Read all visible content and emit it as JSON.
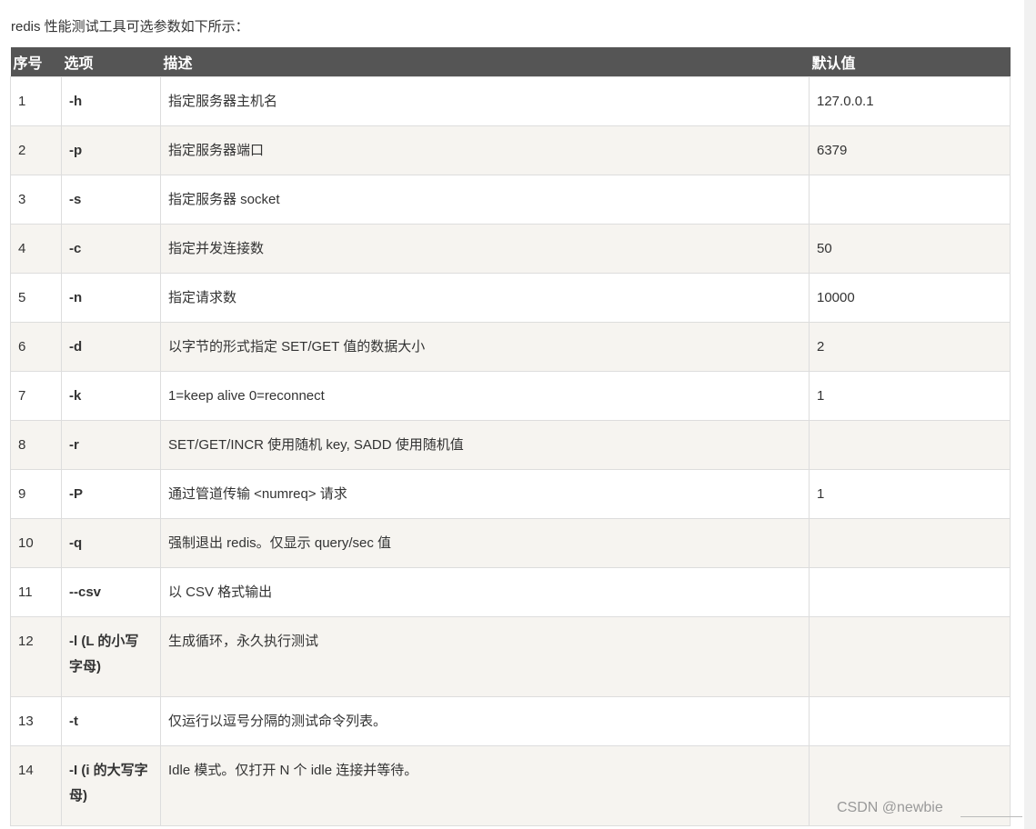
{
  "intro": "redis 性能测试工具可选参数如下所示：",
  "table": {
    "headers": [
      "序号",
      "选项",
      "描述",
      "默认值"
    ],
    "rows": [
      {
        "no": "1",
        "option": "-h",
        "desc": "指定服务器主机名",
        "default": "127.0.0.1"
      },
      {
        "no": "2",
        "option": "-p",
        "desc": "指定服务器端口",
        "default": "6379"
      },
      {
        "no": "3",
        "option": "-s",
        "desc": "指定服务器 socket",
        "default": ""
      },
      {
        "no": "4",
        "option": "-c",
        "desc": "指定并发连接数",
        "default": "50"
      },
      {
        "no": "5",
        "option": "-n",
        "desc": "指定请求数",
        "default": "10000"
      },
      {
        "no": "6",
        "option": "-d",
        "desc": "以字节的形式指定 SET/GET 值的数据大小",
        "default": "2"
      },
      {
        "no": "7",
        "option": "-k",
        "desc": "1=keep alive 0=reconnect",
        "default": "1"
      },
      {
        "no": "8",
        "option": "-r",
        "desc": "SET/GET/INCR 使用随机 key, SADD 使用随机值",
        "default": ""
      },
      {
        "no": "9",
        "option": "-P",
        "desc": "通过管道传输 <numreq> 请求",
        "default": "1"
      },
      {
        "no": "10",
        "option": "-q",
        "desc": "强制退出 redis。仅显示 query/sec 值",
        "default": ""
      },
      {
        "no": "11",
        "option": "--csv",
        "desc": "以 CSV 格式输出",
        "default": ""
      },
      {
        "no": "12",
        "option": "-l (L 的小写字母)",
        "desc": "生成循环，永久执行测试",
        "default": ""
      },
      {
        "no": "13",
        "option": "-t",
        "desc": "仅运行以逗号分隔的测试命令列表。",
        "default": ""
      },
      {
        "no": "14",
        "option": "-I (i 的大写字母)",
        "desc": "Idle 模式。仅打开 N 个 idle 连接并等待。",
        "default": ""
      }
    ]
  },
  "watermark": "CSDN @newbie"
}
